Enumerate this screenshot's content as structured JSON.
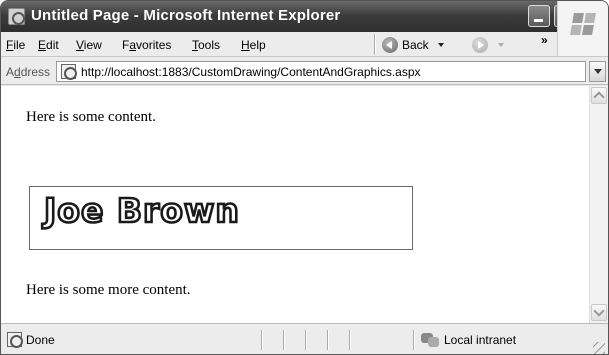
{
  "window": {
    "title": "Untitled Page - Microsoft Internet Explorer",
    "icon": "ie-page-icon"
  },
  "menubar": {
    "items": [
      {
        "prefix": "",
        "accel": "F",
        "rest": "ile"
      },
      {
        "prefix": "",
        "accel": "E",
        "rest": "dit"
      },
      {
        "prefix": "",
        "accel": "V",
        "rest": "iew"
      },
      {
        "prefix": "F",
        "accel": "a",
        "rest": "vorites"
      },
      {
        "prefix": "",
        "accel": "T",
        "rest": "ools"
      },
      {
        "prefix": "",
        "accel": "H",
        "rest": "elp"
      }
    ],
    "back_label": "Back",
    "more": "»"
  },
  "addressbar": {
    "label_prefix": "A",
    "label_accel": "d",
    "label_rest": "dress",
    "url": "http://localhost:1883/CustomDrawing/ContentAndGraphics.aspx"
  },
  "content": {
    "paragraph1": "Here is some content.",
    "graphic_text": "Joe Brown",
    "paragraph2": "Here is some more content."
  },
  "statusbar": {
    "text": "Done",
    "zone": "Local intranet"
  }
}
